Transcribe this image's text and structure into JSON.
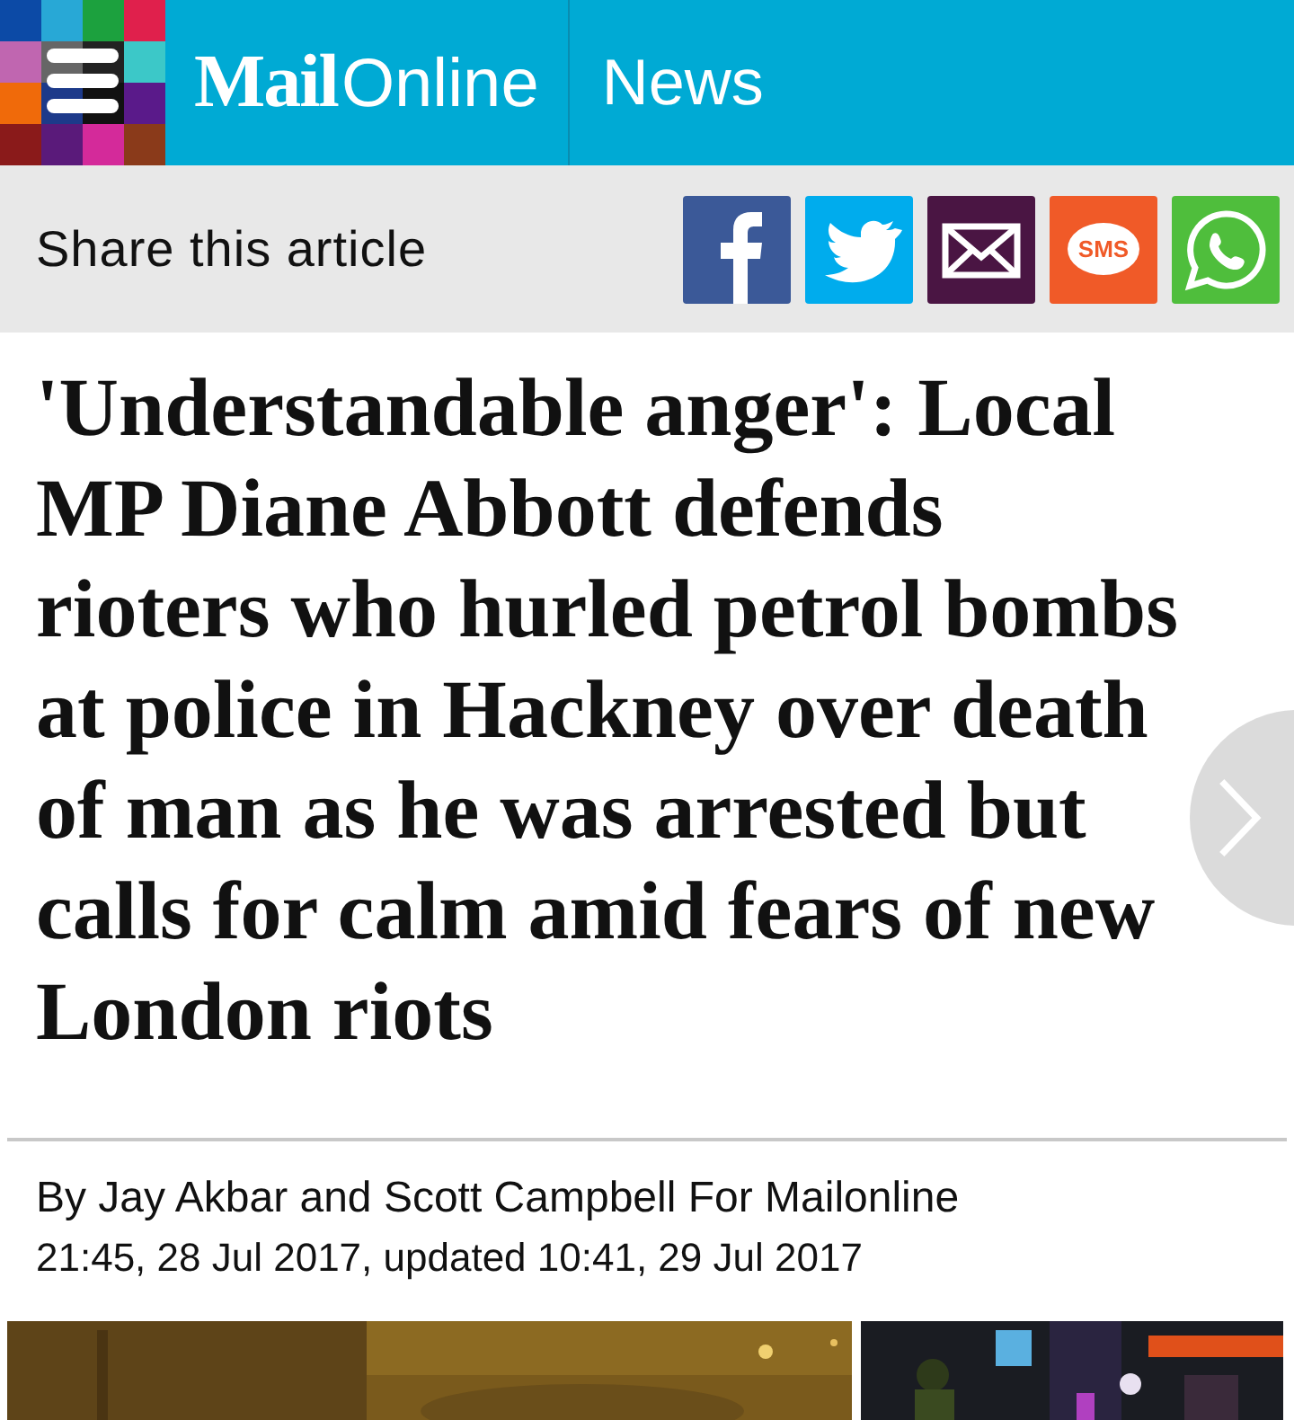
{
  "header": {
    "logo": {
      "part1": "Mail",
      "part2": "Online"
    },
    "section": "News"
  },
  "share": {
    "label": "Share this article",
    "buttons": [
      {
        "kind": "facebook"
      },
      {
        "kind": "twitter"
      },
      {
        "kind": "email"
      },
      {
        "kind": "sms",
        "text": "SMS"
      },
      {
        "kind": "whatsapp"
      }
    ]
  },
  "article": {
    "headline": "'Understandable anger': Local MP Diane Abbott defends rioters who hurled petrol bombs at police in Hackney over death of man as he was arrested but calls for calm amid fears of new London riots",
    "byline": "By Jay Akbar and Scott Campbell For Mailonline",
    "dateline": "21:45, 28 Jul 2017, updated 10:41, 29 Jul 2017"
  }
}
